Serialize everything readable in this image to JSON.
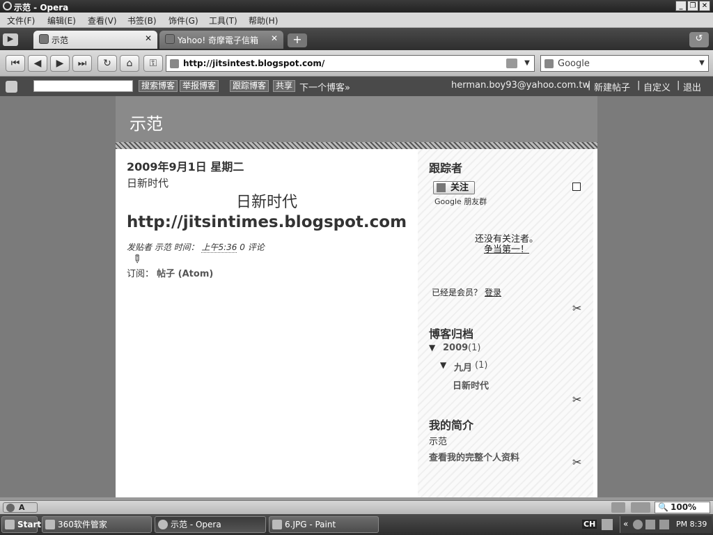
{
  "window": {
    "title": "示范 - Opera"
  },
  "menu": [
    "文件(F)",
    "编辑(E)",
    "查看(V)",
    "书签(B)",
    "饰件(G)",
    "工具(T)",
    "帮助(H)"
  ],
  "tabs": [
    {
      "label": "示范"
    },
    {
      "label": "Yahoo! 奇摩電子信箱"
    }
  ],
  "address": {
    "url": "http://jitsintest.blogspot.com/"
  },
  "search": {
    "engine": "Google"
  },
  "blogger_bar": {
    "buttons": [
      "搜索博客",
      "举报博客",
      "跟踪博客",
      "共享"
    ],
    "next_blog": "下一个博客»",
    "email": "herman.boy93@yahoo.com.tw",
    "links": [
      "新建帖子",
      "自定义",
      "退出"
    ],
    "sep": "|"
  },
  "blog": {
    "title": "示范"
  },
  "post": {
    "date": "2009年9月1日 星期二",
    "title": "日新时代",
    "body_heading": "日新时代",
    "body_url": "http://jitsintimes.blogspot.com",
    "posted_by": "发贴者 示范 时间：",
    "time": "上午5:36",
    "comments": "0 评论",
    "subscribe_label": "订阅：",
    "subscribe_link": "帖子 (Atom)"
  },
  "sidebar": {
    "followers_title": "跟踪者",
    "follow_button": "关注",
    "gfc_label": "Google 朋友群",
    "no_followers": "还没有关注者。",
    "be_first": "争当第一！",
    "member_q": "已经是会员？",
    "login": "登录",
    "archive_title": "博客归档",
    "year": "2009",
    "year_count": "(1)",
    "month": "九月",
    "month_count": "(1)",
    "archive_post": "日新时代",
    "profile_title": "我的简介",
    "profile_name": "示范",
    "profile_link": "查看我的完整个人资料"
  },
  "status": {
    "zoom": "100%",
    "mode": "A"
  },
  "taskbar": {
    "start": "Start",
    "items": [
      "360软件管家",
      "示范 - Opera",
      "6.JPG - Paint"
    ],
    "lang": "CH",
    "clock": "PM 8:39"
  }
}
